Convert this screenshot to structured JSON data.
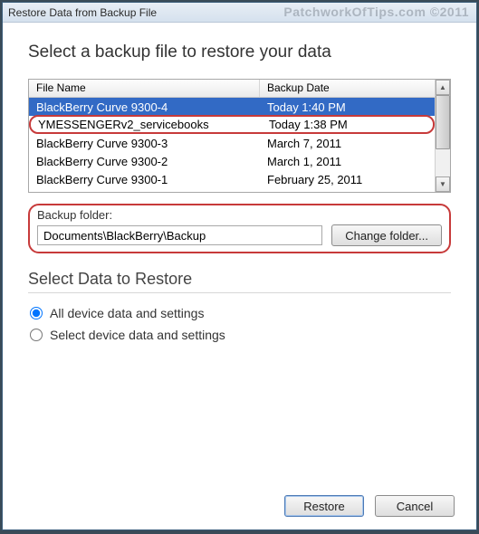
{
  "window": {
    "title": "Restore Data from Backup File"
  },
  "watermark": "PatchworkOfTips.com ©2011",
  "main": {
    "heading": "Select a backup file to restore your data",
    "columns": {
      "name": "File Name",
      "date": "Backup Date"
    },
    "rows": [
      {
        "name": "BlackBerry Curve 9300-4",
        "date": "Today 1:40 PM",
        "selected": true
      },
      {
        "name": "YMESSENGERv2_servicebooks",
        "date": "Today 1:38 PM",
        "highlight": true
      },
      {
        "name": "BlackBerry Curve 9300-3",
        "date": "March 7, 2011"
      },
      {
        "name": "BlackBerry Curve 9300-2",
        "date": "March 1, 2011"
      },
      {
        "name": "BlackBerry Curve 9300-1",
        "date": "February 25, 2011"
      }
    ],
    "folder": {
      "label": "Backup folder:",
      "path": "Documents\\BlackBerry\\Backup",
      "change_label": "Change folder..."
    }
  },
  "restore": {
    "heading": "Select Data to Restore",
    "opt_all": "All device data and settings",
    "opt_select": "Select device data and settings"
  },
  "footer": {
    "restore": "Restore",
    "cancel": "Cancel"
  }
}
